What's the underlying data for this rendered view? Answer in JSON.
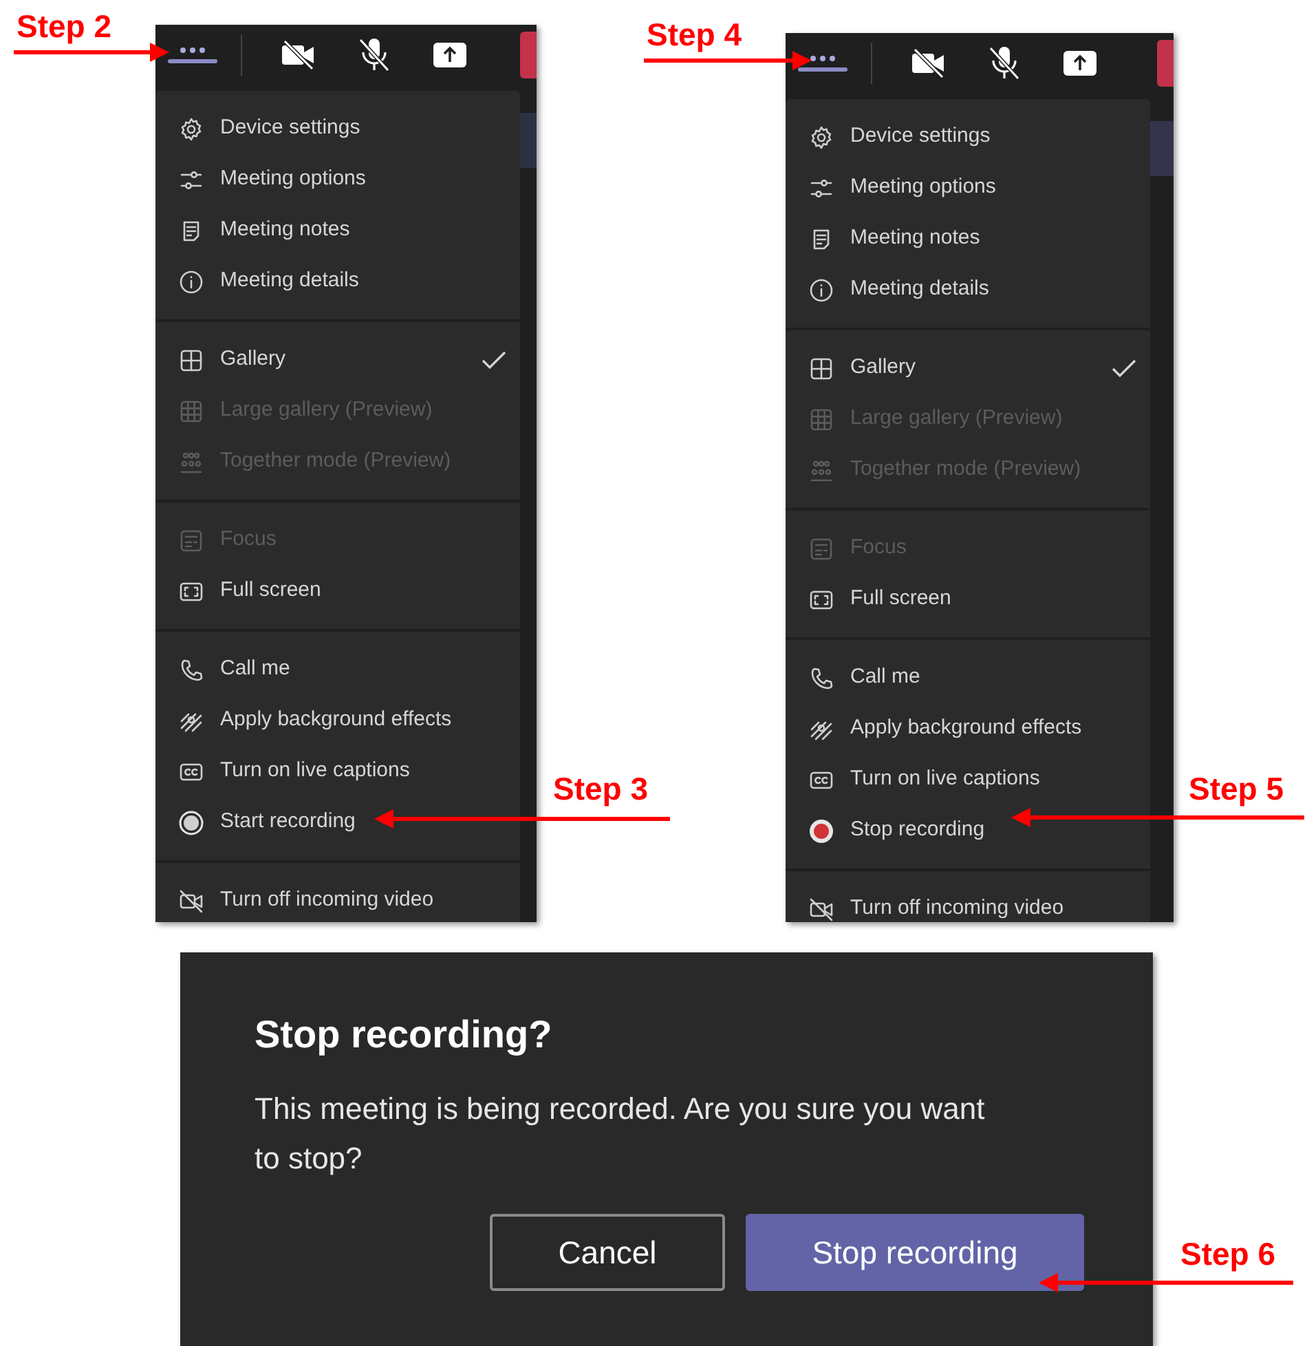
{
  "panels": [
    {
      "groups": [
        [
          {
            "label": "Device settings",
            "kind": "settings",
            "disabled": false
          },
          {
            "label": "Meeting options",
            "kind": "options",
            "disabled": false
          },
          {
            "label": "Meeting notes",
            "kind": "notes",
            "disabled": false
          },
          {
            "label": "Meeting details",
            "kind": "info",
            "disabled": false
          }
        ],
        [
          {
            "label": "Gallery",
            "kind": "gallery",
            "disabled": false,
            "checked": true
          },
          {
            "label": "Large gallery (Preview)",
            "kind": "large-gallery",
            "disabled": true,
            "checked": false
          },
          {
            "label": "Together mode (Preview)",
            "kind": "together",
            "disabled": true,
            "checked": false
          }
        ],
        [
          {
            "label": "Focus",
            "kind": "focus",
            "disabled": true
          },
          {
            "label": "Full screen",
            "kind": "fullscreen",
            "disabled": false
          }
        ],
        [
          {
            "label": "Call me",
            "kind": "phone",
            "disabled": false
          },
          {
            "label": "Apply background effects",
            "kind": "background",
            "disabled": false
          },
          {
            "label": "Turn on live captions",
            "kind": "captions",
            "disabled": false
          },
          {
            "label": "Start recording",
            "kind": "record",
            "disabled": false,
            "recording": false
          }
        ],
        [
          {
            "label": "Turn off incoming video",
            "kind": "video-off",
            "disabled": false
          }
        ]
      ]
    },
    {
      "groups": [
        [
          {
            "label": "Device settings",
            "kind": "settings",
            "disabled": false
          },
          {
            "label": "Meeting options",
            "kind": "options",
            "disabled": false
          },
          {
            "label": "Meeting notes",
            "kind": "notes",
            "disabled": false
          },
          {
            "label": "Meeting details",
            "kind": "info",
            "disabled": false
          }
        ],
        [
          {
            "label": "Gallery",
            "kind": "gallery",
            "disabled": false,
            "checked": true
          },
          {
            "label": "Large gallery (Preview)",
            "kind": "large-gallery",
            "disabled": true,
            "checked": false
          },
          {
            "label": "Together mode (Preview)",
            "kind": "together",
            "disabled": true,
            "checked": false
          }
        ],
        [
          {
            "label": "Focus",
            "kind": "focus",
            "disabled": true
          },
          {
            "label": "Full screen",
            "kind": "fullscreen",
            "disabled": false
          }
        ],
        [
          {
            "label": "Call me",
            "kind": "phone",
            "disabled": false
          },
          {
            "label": "Apply background effects",
            "kind": "background",
            "disabled": false
          },
          {
            "label": "Turn on live captions",
            "kind": "captions",
            "disabled": false
          },
          {
            "label": "Stop recording",
            "kind": "record",
            "disabled": false,
            "recording": true
          }
        ],
        [
          {
            "label": "Turn off incoming video",
            "kind": "video-off",
            "disabled": false
          }
        ]
      ]
    }
  ],
  "dialog": {
    "title": "Stop recording?",
    "message": "This meeting is being recorded. Are you sure you want to stop?",
    "buttons": [
      {
        "label": "Cancel",
        "primary": false
      },
      {
        "label": "Stop recording",
        "primary": true
      }
    ]
  },
  "annotations": [
    {
      "text": "Step 2"
    },
    {
      "text": "Step 3"
    },
    {
      "text": "Step 4"
    },
    {
      "text": "Step 5"
    },
    {
      "text": "Step 6"
    }
  ]
}
